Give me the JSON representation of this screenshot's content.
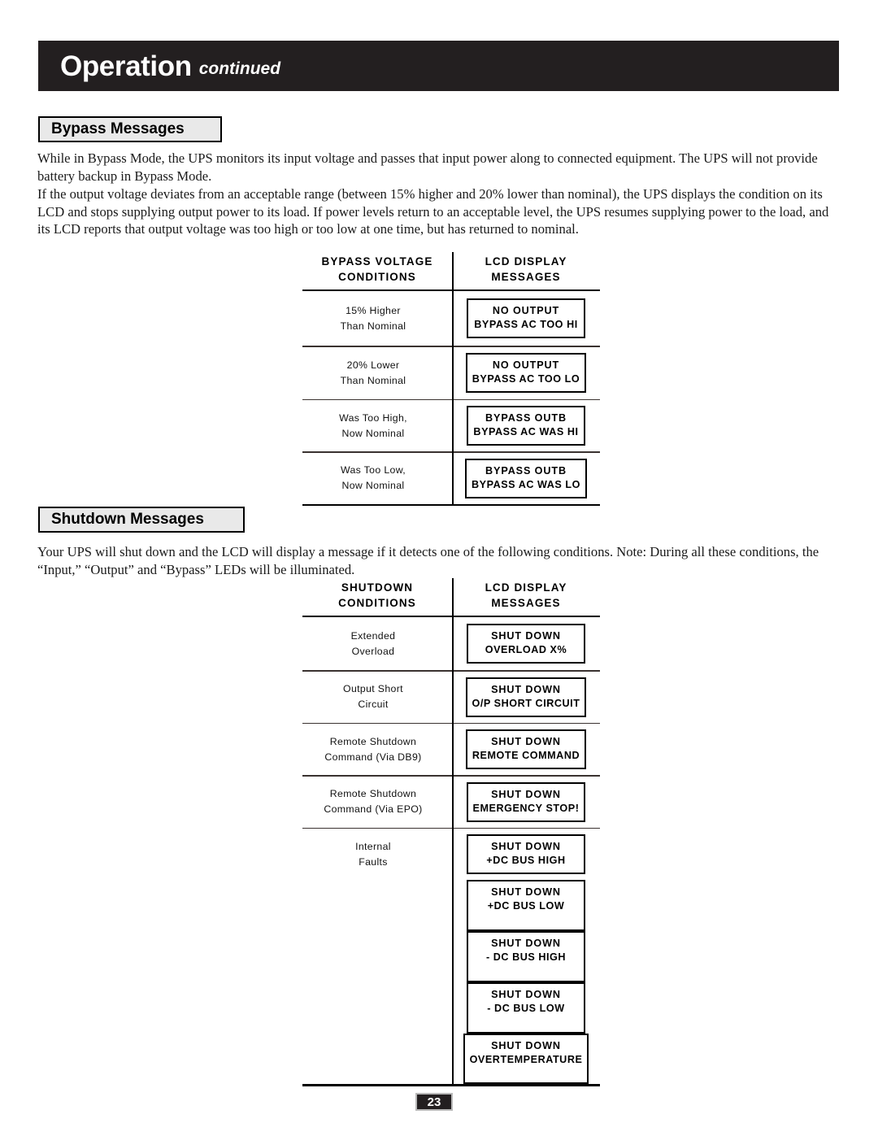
{
  "header": {
    "title": "Operation",
    "subtitle": "continued"
  },
  "sections": {
    "bypass": {
      "heading": "Bypass Messages",
      "paragraphs": [
        "While in Bypass Mode, the UPS monitors its input voltage and passes that input power along to connected equipment. The UPS will not provide battery backup in Bypass Mode.",
        "If the output voltage deviates from an acceptable range (between 15% higher and 20% lower than nominal), the UPS displays the condition on its LCD and stops supplying output power to its load. If power levels return to an acceptable level, the UPS resumes supplying power to the load, and its LCD reports that output voltage was too high or too low at one time, but has returned to nominal."
      ],
      "table": {
        "header_left_line1": "BYPASS VOLTAGE",
        "header_left_line2": "CONDITIONS",
        "header_right_line1": "LCD DISPLAY",
        "header_right_line2": "MESSAGES",
        "rows": [
          {
            "condition_line1": "15% Higher",
            "condition_line2": "Than Nominal",
            "lcd_line1": "NO OUTPUT",
            "lcd_line2": "BYPASS AC TOO HI"
          },
          {
            "condition_line1": "20% Lower",
            "condition_line2": "Than Nominal",
            "lcd_line1": "NO OUTPUT",
            "lcd_line2": "BYPASS AC TOO LO"
          },
          {
            "condition_line1": "Was Too High,",
            "condition_line2": "Now Nominal",
            "lcd_line1": "BYPASS OUTB",
            "lcd_line2": "BYPASS AC WAS HI"
          },
          {
            "condition_line1": "Was Too Low,",
            "condition_line2": "Now Nominal",
            "lcd_line1": "BYPASS OUTB",
            "lcd_line2": "BYPASS AC WAS LO"
          }
        ]
      }
    },
    "shutdown": {
      "heading": "Shutdown Messages",
      "paragraphs": [
        "Your UPS will shut down and the LCD will display a message if it detects one of the following conditions. Note: During all these conditions, the “Input,” “Output” and “Bypass” LEDs will be illuminated."
      ],
      "table": {
        "header_left_line1": "SHUTDOWN",
        "header_left_line2": "CONDITIONS",
        "header_right_line1": "LCD DISPLAY",
        "header_right_line2": "MESSAGES",
        "rows": [
          {
            "condition_line1": "Extended",
            "condition_line2": "Overload",
            "lcd_line1": "SHUT DOWN",
            "lcd_line2": "OVERLOAD X%"
          },
          {
            "condition_line1": "Output Short",
            "condition_line2": "Circuit",
            "lcd_line1": "SHUT DOWN",
            "lcd_line2": "O/P SHORT CIRCUIT"
          },
          {
            "condition_line1": "Remote Shutdown",
            "condition_line2": "Command (Via DB9)",
            "lcd_line1": "SHUT DOWN",
            "lcd_line2": "REMOTE COMMAND"
          },
          {
            "condition_line1": "Remote Shutdown",
            "condition_line2": "Command (Via EPO)",
            "lcd_line1": "SHUT DOWN",
            "lcd_line2": "EMERGENCY STOP!"
          },
          {
            "condition_line1": "Internal",
            "condition_line2": "Faults",
            "lcd_line1": "SHUT DOWN",
            "lcd_line2": "+DC BUS HIGH"
          }
        ],
        "internal_fault_extra": [
          {
            "lcd_line1": "SHUT DOWN",
            "lcd_line2": "+DC BUS LOW"
          },
          {
            "lcd_line1": "SHUT DOWN",
            "lcd_line2": "- DC BUS HIGH"
          },
          {
            "lcd_line1": "SHUT DOWN",
            "lcd_line2": "- DC BUS LOW"
          },
          {
            "lcd_line1": "SHUT DOWN",
            "lcd_line2": "OVERTEMPERATURE"
          }
        ]
      }
    }
  },
  "footer": {
    "page_number": "23"
  }
}
